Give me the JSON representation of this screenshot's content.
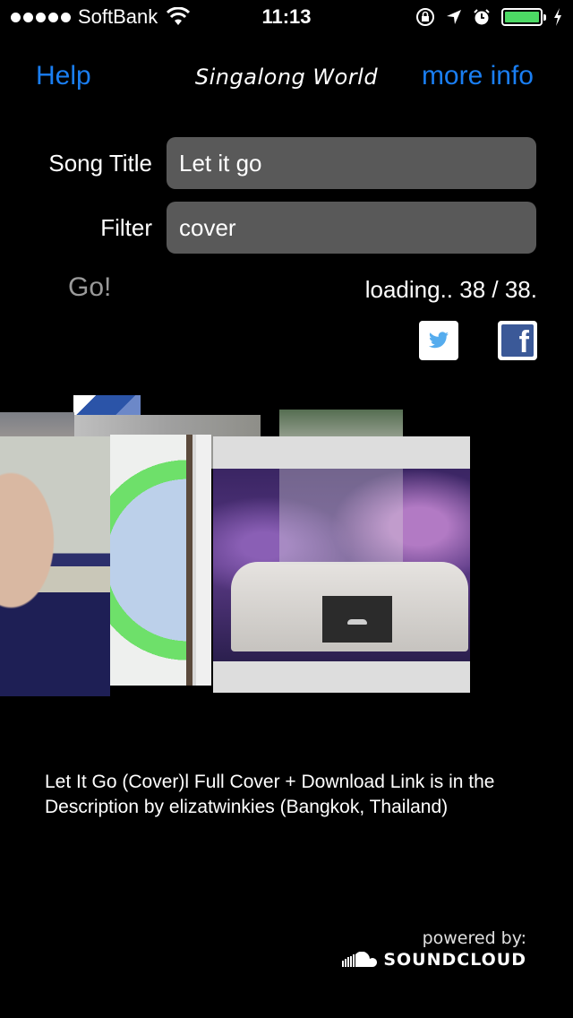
{
  "status_bar": {
    "signal_dots": 5,
    "carrier": "SoftBank",
    "time": "11:13",
    "battery_level": 1.0,
    "icons": [
      "wifi-icon",
      "rotation-lock-icon",
      "location-icon",
      "alarm-icon",
      "battery-icon",
      "charging-icon"
    ]
  },
  "nav": {
    "help_label": "Help",
    "title": "Singalong World",
    "more_info_label": "more info",
    "link_color": "#1a7ef2"
  },
  "form": {
    "song_title_label": "Song Title",
    "song_title_value": "Let it go",
    "filter_label": "Filter",
    "filter_value": "cover",
    "go_label": "Go!",
    "loading_text": "loading.. 38 / 38."
  },
  "share": {
    "twitter_icon": "twitter-icon",
    "facebook_icon": "facebook-icon",
    "facebook_glyph": "f"
  },
  "coverflow": {
    "items": [
      {
        "name": "cover-flag"
      },
      {
        "name": "cover-back-1"
      },
      {
        "name": "cover-back-2"
      },
      {
        "name": "cover-back-3"
      },
      {
        "name": "cover-left"
      },
      {
        "name": "cover-green-circle"
      },
      {
        "name": "cover-strip"
      },
      {
        "name": "cover-main-selected"
      }
    ]
  },
  "track": {
    "description": "Let It Go (Cover)l Full Cover + Download Link is in the Description by elizatwinkies (Bangkok, Thailand)"
  },
  "footer": {
    "powered_by": "powered by:",
    "brand": "SOUNDCLOUD"
  }
}
